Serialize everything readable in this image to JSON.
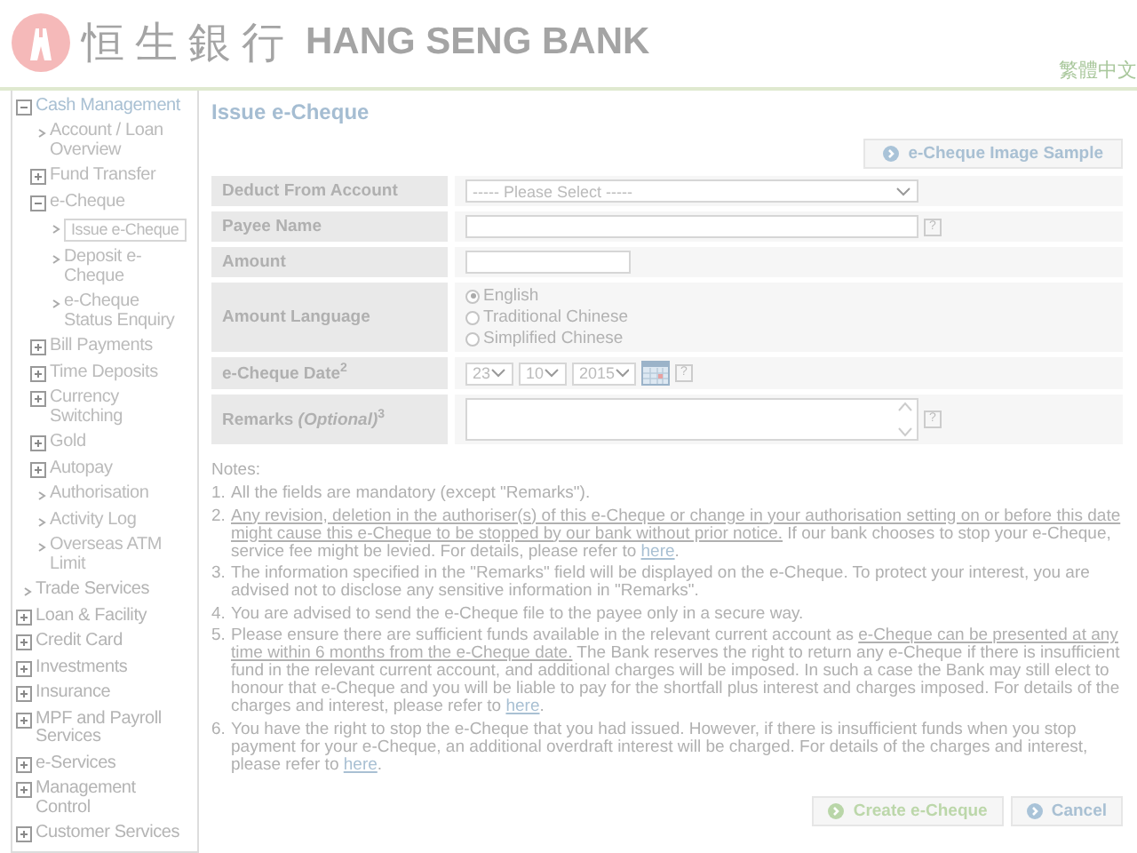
{
  "header": {
    "logo_chinese": "恒生銀行",
    "logo_english": "HANG SENG BANK",
    "language_link": "繁體中文"
  },
  "sidebar": {
    "items": [
      {
        "label": "Cash Management",
        "kind": "group",
        "expanded": true,
        "selected": false,
        "children": [
          {
            "label": "Account / Loan Overview",
            "kind": "link",
            "selected": false
          },
          {
            "label": "Fund Transfer",
            "kind": "group",
            "expanded": false,
            "selected": false
          },
          {
            "label": "e-Cheque",
            "kind": "group",
            "expanded": true,
            "selected": false,
            "children": [
              {
                "label": "Issue e-Cheque",
                "kind": "link",
                "selected": true
              },
              {
                "label": "Deposit e-Cheque",
                "kind": "link",
                "selected": false
              },
              {
                "label": "e-Cheque Status Enquiry",
                "kind": "link",
                "selected": false
              }
            ]
          },
          {
            "label": "Bill Payments",
            "kind": "group",
            "expanded": false,
            "selected": false
          },
          {
            "label": "Time Deposits",
            "kind": "group",
            "expanded": false,
            "selected": false
          },
          {
            "label": "Currency Switching",
            "kind": "group",
            "expanded": false,
            "selected": false
          },
          {
            "label": "Gold",
            "kind": "group",
            "expanded": false,
            "selected": false
          },
          {
            "label": "Autopay",
            "kind": "group",
            "expanded": false,
            "selected": false
          },
          {
            "label": "Authorisation",
            "kind": "link",
            "selected": false
          },
          {
            "label": "Activity Log",
            "kind": "link",
            "selected": false
          },
          {
            "label": "Overseas ATM Limit",
            "kind": "link",
            "selected": false
          }
        ]
      },
      {
        "label": "Trade Services",
        "kind": "link",
        "selected": false
      },
      {
        "label": "Loan & Facility",
        "kind": "group",
        "expanded": false,
        "selected": false
      },
      {
        "label": "Credit Card",
        "kind": "group",
        "expanded": false,
        "selected": false
      },
      {
        "label": "Investments",
        "kind": "group",
        "expanded": false,
        "selected": false
      },
      {
        "label": "Insurance",
        "kind": "group",
        "expanded": false,
        "selected": false
      },
      {
        "label": "MPF and Payroll Services",
        "kind": "group",
        "expanded": false,
        "selected": false
      },
      {
        "label": "e-Services",
        "kind": "group",
        "expanded": false,
        "selected": false
      },
      {
        "label": "Management Control",
        "kind": "group",
        "expanded": false,
        "selected": false
      },
      {
        "label": "Customer Services",
        "kind": "group",
        "expanded": false,
        "selected": false
      }
    ]
  },
  "page": {
    "title": "Issue e-Cheque",
    "sample_button": "e-Cheque Image Sample"
  },
  "form": {
    "rows": [
      {
        "label": "Deduct From Account",
        "kind": "select",
        "value": "----- Please Select -----"
      },
      {
        "label": "Payee Name",
        "kind": "text",
        "help": "?"
      },
      {
        "label": "Amount",
        "kind": "short_text"
      },
      {
        "label": "Amount Language",
        "kind": "radio",
        "options": [
          {
            "label": "English",
            "selected": true
          },
          {
            "label": "Traditional Chinese",
            "selected": false
          },
          {
            "label": "Simplified Chinese",
            "selected": false
          }
        ]
      },
      {
        "label": "e-Cheque Date$^{2}$",
        "kind": "date",
        "day": "23",
        "month": "10",
        "year": "2015",
        "help": "?"
      },
      {
        "label": "Remarks *(Optional)*$^{3}$",
        "kind": "textarea",
        "help": "?"
      }
    ]
  },
  "notes": {
    "heading": "Notes:",
    "items": [
      {
        "number": "1.",
        "segments": [
          {
            "kind": "plain",
            "text": "All the fields are mandatory (except \"Remarks\")."
          }
        ]
      },
      {
        "number": "2.",
        "segments": [
          {
            "kind": "underline",
            "text": "Any revision, deletion in the authoriser(s) of this e-Cheque or change in your authorisation setting on or before this date might cause this e-Cheque to be stopped by our bank without prior notice."
          },
          {
            "kind": "plain",
            "text": " If our bank chooses to stop your e-Cheque, service fee might be levied. For details, please refer to "
          },
          {
            "kind": "link",
            "text": "here"
          },
          {
            "kind": "plain",
            "text": "."
          }
        ]
      },
      {
        "number": "3.",
        "segments": [
          {
            "kind": "plain",
            "text": "The information specified in the \"Remarks\" field will be displayed on the e-Cheque. To protect your interest, you are advised not to disclose any sensitive information in \"Remarks\"."
          }
        ]
      },
      {
        "number": "4.",
        "segments": [
          {
            "kind": "plain",
            "text": "You are advised to send the e-Cheque file to the payee only in a secure way."
          }
        ]
      },
      {
        "number": "5.",
        "segments": [
          {
            "kind": "plain",
            "text": "Please ensure there are sufficient funds available in the relevant current account as "
          },
          {
            "kind": "underline",
            "text": "e-Cheque can be presented at any time within 6 months from the e-Cheque date."
          },
          {
            "kind": "plain",
            "text": " The Bank reserves the right to return any e-Cheque if there is insufficient fund in the relevant current account, and additional charges will be imposed. In such a case the Bank may still elect to honour that e-Cheque and you will be liable to pay for the shortfall plus interest and charges imposed. For details of the charges and interest, please refer to "
          },
          {
            "kind": "link",
            "text": "here"
          },
          {
            "kind": "plain",
            "text": "."
          }
        ]
      },
      {
        "number": "6.",
        "segments": [
          {
            "kind": "plain",
            "text": "You have the right to stop the e-Cheque that you had issued. However, if there is insufficient funds when you stop payment for your e-Cheque, an additional overdraft interest will be charged. For details of the charges and interest, please refer to "
          },
          {
            "kind": "link",
            "text": "here"
          },
          {
            "kind": "plain",
            "text": "."
          }
        ]
      }
    ]
  },
  "actions": [
    {
      "label": "Create e-Cheque",
      "kind": "primary"
    },
    {
      "label": "Cancel",
      "kind": "secondary"
    }
  ]
}
